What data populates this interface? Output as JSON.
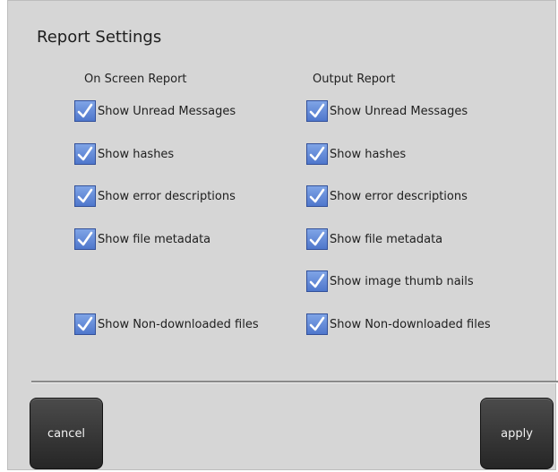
{
  "dialog": {
    "title": "Report Settings"
  },
  "columns": {
    "on_screen": {
      "header": "On Screen Report",
      "options": [
        {
          "label": "Show Unread Messages",
          "checked": true
        },
        {
          "label": "Show hashes",
          "checked": true
        },
        {
          "label": "Show error descriptions",
          "checked": true
        },
        {
          "label": "Show file metadata",
          "checked": true
        },
        {
          "label": "Show Non-downloaded files",
          "checked": true
        }
      ]
    },
    "output": {
      "header": "Output Report",
      "options": [
        {
          "label": "Show Unread Messages",
          "checked": true
        },
        {
          "label": "Show hashes",
          "checked": true
        },
        {
          "label": "Show error descriptions",
          "checked": true
        },
        {
          "label": "Show file metadata",
          "checked": true
        },
        {
          "label": "Show image thumb nails",
          "checked": true
        },
        {
          "label": "Show Non-downloaded files",
          "checked": true
        }
      ]
    }
  },
  "buttons": {
    "cancel": "cancel",
    "apply": "apply"
  },
  "colors": {
    "panel_bg": "#d6d6d6",
    "checkbox_fill": "#5b82d4",
    "button_bg": "#333333"
  }
}
